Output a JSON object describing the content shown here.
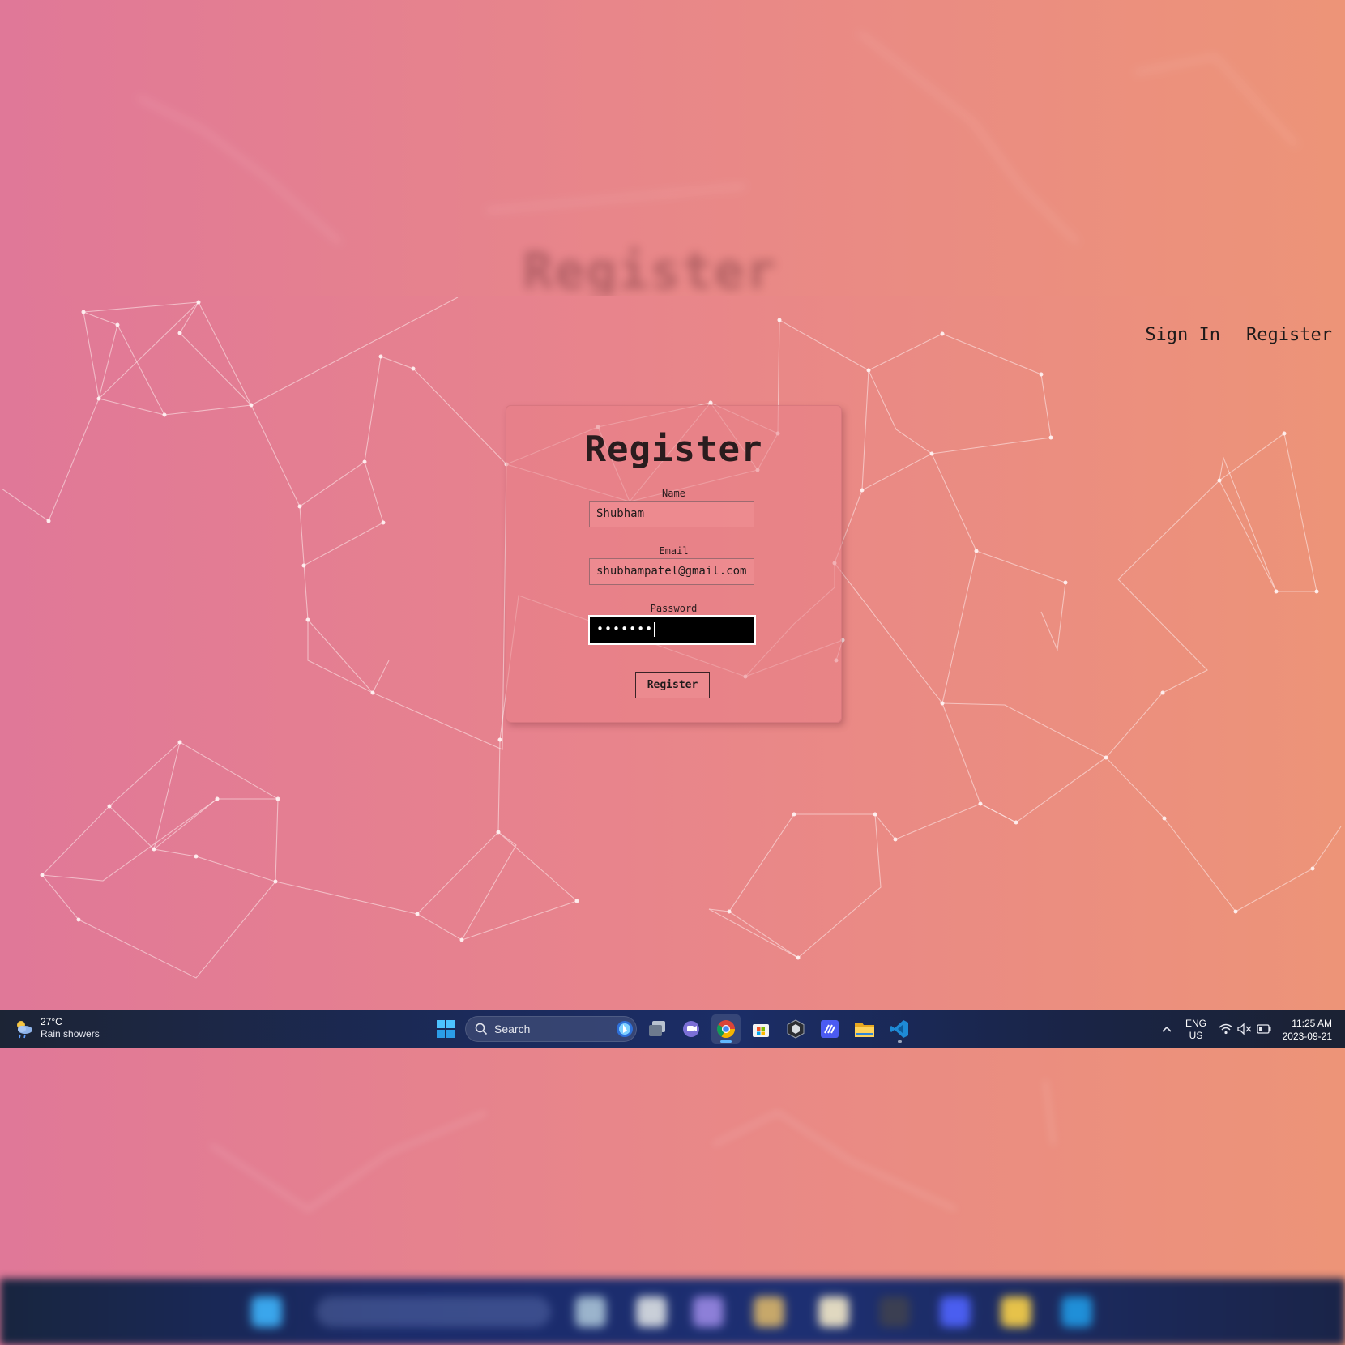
{
  "page": {
    "title": "Register",
    "nav": {
      "sign_in": "Sign In",
      "register": "Register"
    }
  },
  "form": {
    "name_label": "Name",
    "name_value": "Shubham",
    "email_label": "Email",
    "email_value": "shubhampatel@gmail.com",
    "password_label": "Password",
    "password_value": "•••••••",
    "submit_label": "Register"
  },
  "taskbar": {
    "weather_temp": "27°C",
    "weather_condition": "Rain showers",
    "search_placeholder": "Search",
    "lang_top": "ENG",
    "lang_bottom": "US",
    "time": "11:25 AM",
    "date": "2023-09-21",
    "apps": [
      "windows-start-icon",
      "task-view-icon",
      "teams-chat-icon",
      "chrome-icon",
      "microsoft-store-icon",
      "unity-icon",
      "visual-studio-icon",
      "file-explorer-icon",
      "vscode-icon"
    ],
    "active_app": "chrome-icon"
  },
  "colors": {
    "gradient_left": "#e07898",
    "gradient_right": "#ed9478",
    "taskbar": "#1b2a5a",
    "accent": "#60b8ff"
  }
}
